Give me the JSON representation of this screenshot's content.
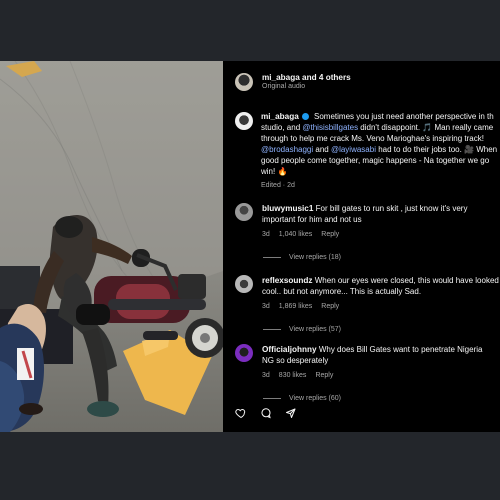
{
  "post_header": {
    "authors": "mi_abaga and 4 others",
    "audio": "Original audio"
  },
  "caption": {
    "username": "mi_abaga",
    "segments": [
      {
        "text": " Sometimes you just need another perspective in th studio, and ",
        "link": false
      },
      {
        "text": "@thisisbillgates",
        "link": true
      },
      {
        "text": " didn't disappoint. ",
        "link": false
      },
      {
        "text": "🎵",
        "link": false
      },
      {
        "text": " Man really came through to help me crack Ms. Veno Marioghae's inspiring track! ",
        "link": false
      },
      {
        "text": "@brodashaggi",
        "link": true
      },
      {
        "text": " and ",
        "link": false
      },
      {
        "text": "@layiwasabi",
        "link": true
      },
      {
        "text": " had to do their jobs too.",
        "link": false
      },
      {
        "text": " 🎥 When good people come together, magic happens - Na together we go win! ",
        "link": false
      },
      {
        "text": "🔥",
        "link": false
      }
    ],
    "meta": "Edited · 2d"
  },
  "comments": [
    {
      "username": "bluwymusic1",
      "text": " For bill gates to run skit , just know it's very important for him and not us",
      "time": "3d",
      "likes": "1,040 likes",
      "reply": "Reply",
      "view_replies": "View replies (18)"
    },
    {
      "username": "reflexsoundz",
      "text": " When our eyes were closed, this would have looked cool.. but not anymore... This is actually Sad.",
      "time": "3d",
      "likes": "1,869 likes",
      "reply": "Reply",
      "view_replies": "View replies (57)"
    },
    {
      "username": "Officialjohnny",
      "text": " Why does Bill Gates want to penetrate Nigeria ",
      "text_extra": "NG so desperately",
      "time": "3d",
      "likes": "830 likes",
      "reply": "Reply",
      "view_replies": "View replies (60)"
    }
  ],
  "actions": {
    "like_icon": "heart-icon",
    "comment_icon": "comment-icon",
    "share_icon": "send-icon"
  }
}
